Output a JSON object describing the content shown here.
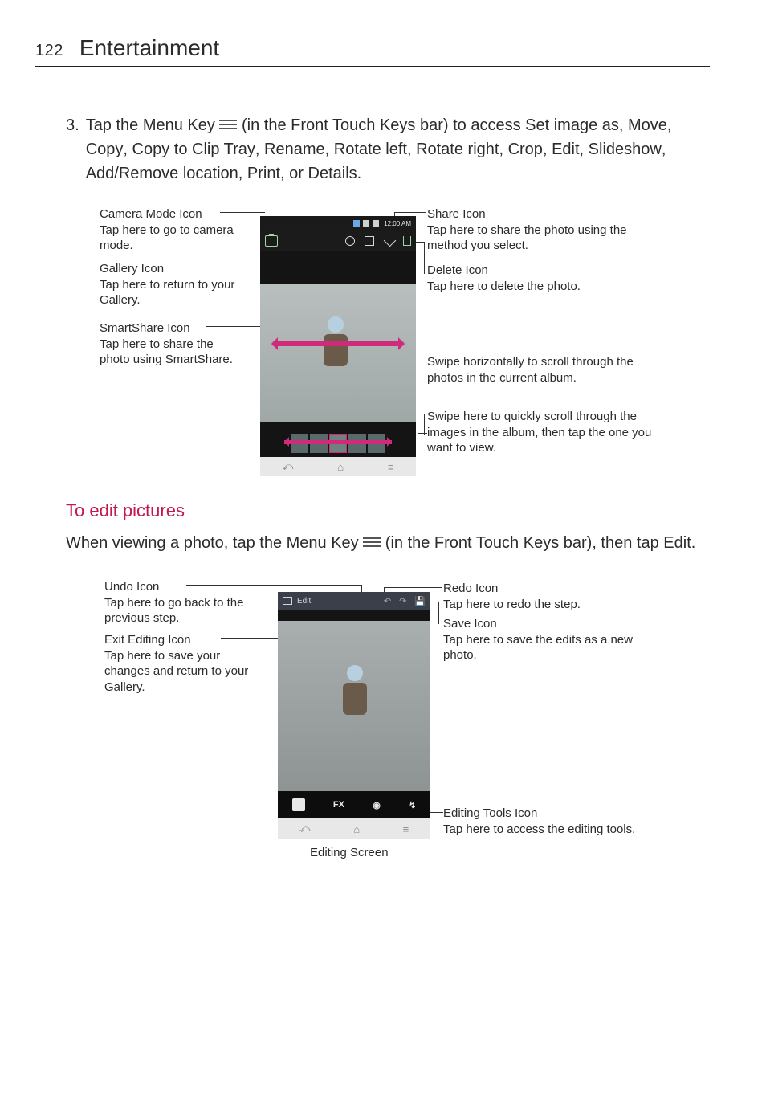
{
  "pageNumber": "122",
  "pageTitle": "Entertainment",
  "step3": {
    "num": "3.",
    "pre": "Tap the ",
    "menuKey": "Menu Key ",
    "mid": " (in the Front Touch Keys bar) to access ",
    "opts1": "Set image as",
    "opts2": "Move",
    "opts3": "Copy",
    "opts4": "Copy to Clip Tray",
    "opts5": "Rename",
    "opts6": "Rotate left",
    "opts7": "Rotate right",
    "opts8": "Crop",
    "opts9": "Edit",
    "opts10": "Slideshow",
    "opts11": "Add/Remove location",
    "opts12": "Print,",
    "or": " or ",
    "opts13": "Details",
    "period": "."
  },
  "time1": "12:00 AM",
  "callouts1": {
    "cameraTitle": "Camera Mode Icon",
    "cameraDesc": "Tap here to go to camera mode.",
    "galleryTitle": "Gallery Icon",
    "galleryDesc": "Tap here to return to your Gallery.",
    "smartTitle": "SmartShare Icon",
    "smartDesc": "Tap here to share the photo using SmartShare.",
    "shareTitle": "Share Icon",
    "shareDesc": "Tap here to share the photo using the method you select.",
    "deleteTitle": "Delete Icon",
    "deleteDesc": "Tap here to delete the photo.",
    "swipe1": "Swipe horizontally to scroll through the photos in the current album.",
    "swipe2": "Swipe here to quickly scroll through the images in the album, then tap the one you want to view."
  },
  "sectionHeading": "To edit pictures",
  "editPara": {
    "pre": "When viewing a photo, tap the ",
    "menuKey": "Menu Key ",
    "mid": " (in the Front Touch Keys bar), then tap ",
    "edit": "Edit",
    "period": "."
  },
  "editLabel": "Edit",
  "fxLabel": "FX",
  "callouts2": {
    "undoTitle": "Undo Icon",
    "undoDesc": "Tap here to go back to the previous step.",
    "exitTitle": "Exit Editing Icon",
    "exitDesc": "Tap here to save your changes and return to your Gallery.",
    "redoTitle": "Redo Icon",
    "redoDesc": "Tap here to redo the step.",
    "saveTitle": "Save Icon",
    "saveDesc": "Tap here to save the edits as a new photo.",
    "toolsTitle": "Editing Tools Icon",
    "toolsDesc": "Tap here to access the editing tools."
  },
  "caption2": "Editing Screen"
}
